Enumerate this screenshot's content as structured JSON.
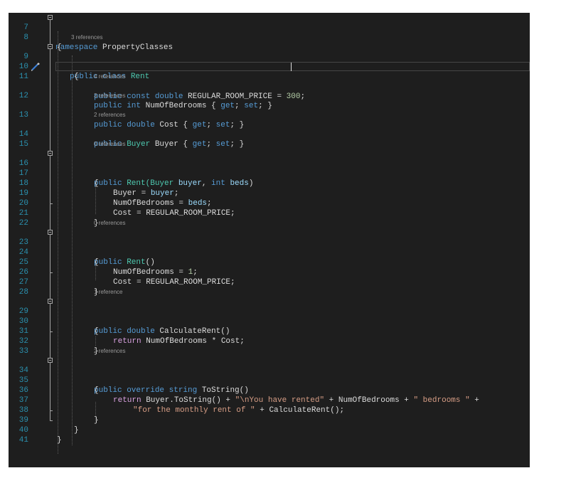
{
  "editor": {
    "namespace_name": "PropertyClasses",
    "class_name": "Rent",
    "current_line": 11,
    "cursor_after_text": "public const double REGULAR_ROOM_PRICE = 3",
    "line_numbers": [
      "7",
      "8",
      "9",
      "10",
      "11",
      "12",
      "13",
      "14",
      "15",
      "16",
      "17",
      "18",
      "19",
      "20",
      "21",
      "22",
      "23",
      "24",
      "25",
      "26",
      "27",
      "28",
      "29",
      "30",
      "31",
      "32",
      "33",
      "34",
      "35",
      "36",
      "37",
      "38",
      "39",
      "40",
      "41"
    ],
    "codelens": {
      "class_rent": "3 references",
      "num_of_bedrooms": "4 references",
      "cost": "3 references",
      "buyer": "2 references",
      "ctor_with_args": "0 references",
      "ctor_default": "0 references",
      "calculate_rent": "1 reference",
      "to_string": "2 references"
    },
    "code": {
      "l7_kw": "namespace",
      "l7_name": " PropertyClasses",
      "l8": "{",
      "l9_kw": "public class",
      "l9_name": " Rent",
      "l10": "{",
      "l11_kw": "public const double",
      "l11_name": " REGULAR_ROOM_PRICE = ",
      "l11_num": "300",
      "l11_end": ";",
      "l12_kw": "public int",
      "l12_name": " NumOfBedrooms { ",
      "l12_get": "get",
      "l12_mid": "; ",
      "l12_set": "set",
      "l12_end": "; }",
      "l13_kw": "public double",
      "l13_name": " Cost { ",
      "l13_get": "get",
      "l13_mid": "; ",
      "l13_set": "set",
      "l13_end": "; }",
      "l14_kw": "public",
      "l14_type": " Buyer",
      "l14_name": " Buyer { ",
      "l14_get": "get",
      "l14_mid": "; ",
      "l14_set": "set",
      "l14_end": "; }",
      "l16_kw": "public",
      "l16_name": " Rent(",
      "l16_type": "Buyer",
      "l16_p1": " buyer",
      "l16_comma": ", ",
      "l16_int": "int",
      "l16_p2": " beds",
      "l16_end": ")",
      "l17": "{",
      "l18_a": "Buyer = ",
      "l18_b": "buyer",
      "l18_c": ";",
      "l19_a": "NumOfBedrooms = ",
      "l19_b": "beds",
      "l19_c": ";",
      "l20": "Cost = REGULAR_ROOM_PRICE;",
      "l21": "}",
      "l23_kw": "public",
      "l23_name": " Rent",
      "l23_end": "()",
      "l24": "{",
      "l25_a": "NumOfBedrooms = ",
      "l25_num": "1",
      "l25_c": ";",
      "l26": "Cost = REGULAR_ROOM_PRICE;",
      "l27": "}",
      "l29_kw": "public double",
      "l29_name": " CalculateRent()",
      "l30": "{",
      "l31_kw": "return",
      "l31_rest": " NumOfBedrooms * Cost;",
      "l32": "}",
      "l34_kw": "public override string",
      "l34_name": " ToString()",
      "l35": "{",
      "l36_kw": "return",
      "l36_a": " Buyer.ToString() + ",
      "l36_s1": "\"\\nYou have rented\"",
      "l36_b": " + NumOfBedrooms + ",
      "l36_s2": "\" bedrooms \"",
      "l36_c": " +",
      "l37_s": "\"for the monthly rent of \"",
      "l37_rest": " + CalculateRent();",
      "l38": "}",
      "l39": "}",
      "l40": "}"
    }
  }
}
